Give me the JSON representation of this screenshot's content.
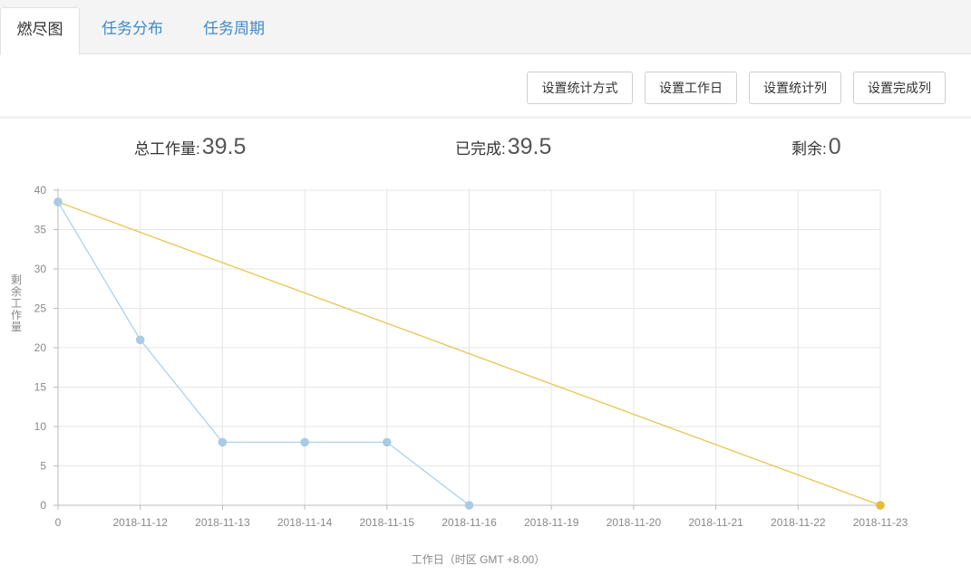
{
  "tabs": [
    {
      "label": "燃尽图",
      "active": true
    },
    {
      "label": "任务分布",
      "active": false
    },
    {
      "label": "任务周期",
      "active": false
    }
  ],
  "toolbar": {
    "buttons": [
      {
        "label": "设置统计方式"
      },
      {
        "label": "设置工作日"
      },
      {
        "label": "设置统计列"
      },
      {
        "label": "设置完成列"
      }
    ]
  },
  "stats": {
    "total_label": "总工作量:",
    "total_value": "39.5",
    "done_label": "已完成:",
    "done_value": "39.5",
    "remaining_label": "剩余:",
    "remaining_value": "0"
  },
  "colors": {
    "actual_line": "#a9d3ec",
    "actual_point": "#a9cbe3",
    "ideal_line": "#e6c54e",
    "ideal_point": "#e3bd36",
    "tab_link": "#3d8ac8",
    "grid": "#e6e6e6",
    "axis": "#bbbbbb"
  },
  "chart_data": {
    "type": "line",
    "xlabel": "工作日（时区 GMT +8.00）",
    "ylabel": "剩余工作量",
    "categories": [
      "0",
      "2018-11-12",
      "2018-11-13",
      "2018-11-14",
      "2018-11-15",
      "2018-11-16",
      "2018-11-19",
      "2018-11-20",
      "2018-11-21",
      "2018-11-22",
      "2018-11-23"
    ],
    "ylim": [
      0,
      40
    ],
    "yticks": [
      0,
      5,
      10,
      15,
      20,
      25,
      30,
      35,
      40
    ],
    "grid": true,
    "series": [
      {
        "key": "actual",
        "values": [
          38.5,
          21,
          8,
          8,
          8,
          0,
          null,
          null,
          null,
          null,
          null
        ]
      },
      {
        "key": "ideal",
        "values": [
          38.5,
          null,
          null,
          null,
          null,
          null,
          null,
          null,
          null,
          null,
          0
        ]
      }
    ]
  }
}
